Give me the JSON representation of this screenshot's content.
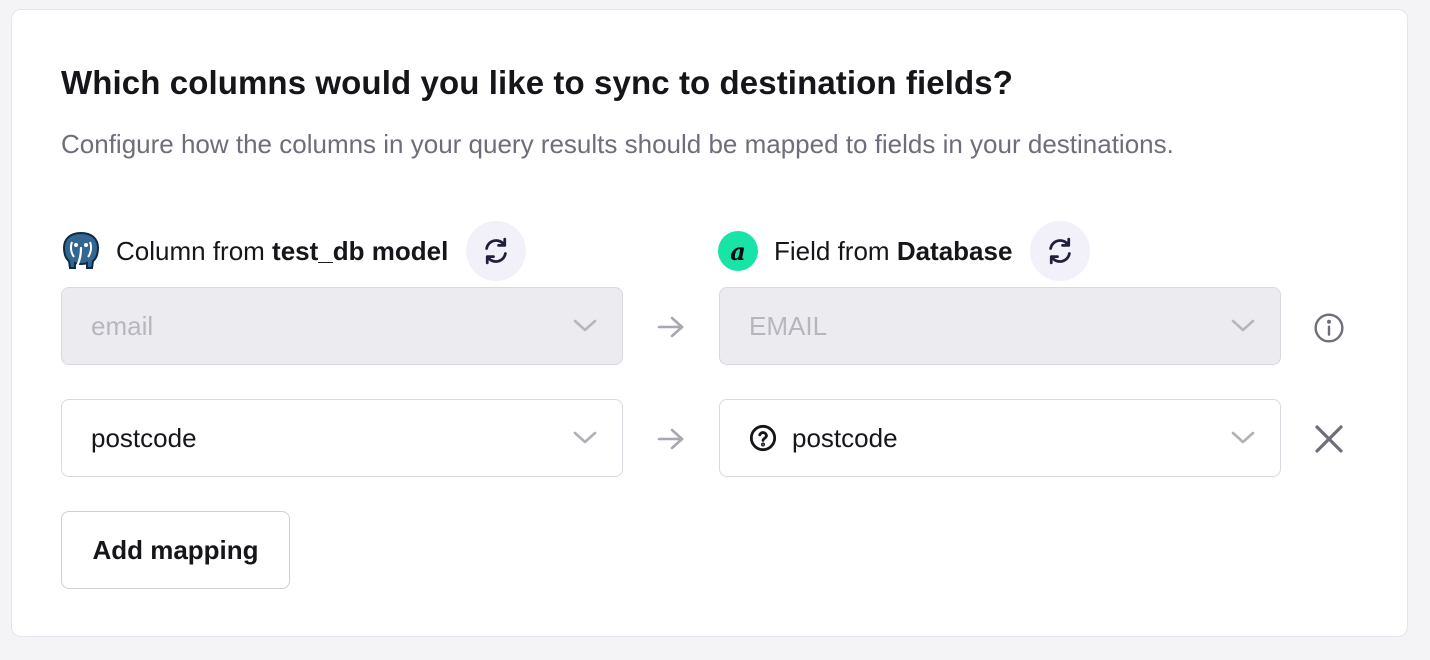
{
  "title": "Which columns would you like to sync to destination fields?",
  "subtitle": "Configure how the columns in your query results should be mapped to fields in your destinations.",
  "source_header": {
    "prefix": "Column from ",
    "source_name": "test_db model",
    "icon": "postgres-elephant-icon"
  },
  "destination_header": {
    "prefix": "Field from ",
    "destination_name": "Database",
    "icon": "attio-logo-icon",
    "icon_letter": "a"
  },
  "mappings": [
    {
      "source": "email",
      "destination": "EMAIL",
      "disabled": true,
      "action_icon": "info-icon"
    },
    {
      "source": "postcode",
      "destination": "postcode",
      "disabled": false,
      "destination_icon": "question-circle-icon",
      "action_icon": "close-icon"
    }
  ],
  "add_button_label": "Add mapping",
  "colors": {
    "attio_green": "#17e4a6",
    "refresh_bg": "#f2f1fa",
    "refresh_icon": "#20203a",
    "disabled_bg": "#ececf0",
    "disabled_text": "#b6b6be",
    "postgres_blue": "#336791"
  }
}
